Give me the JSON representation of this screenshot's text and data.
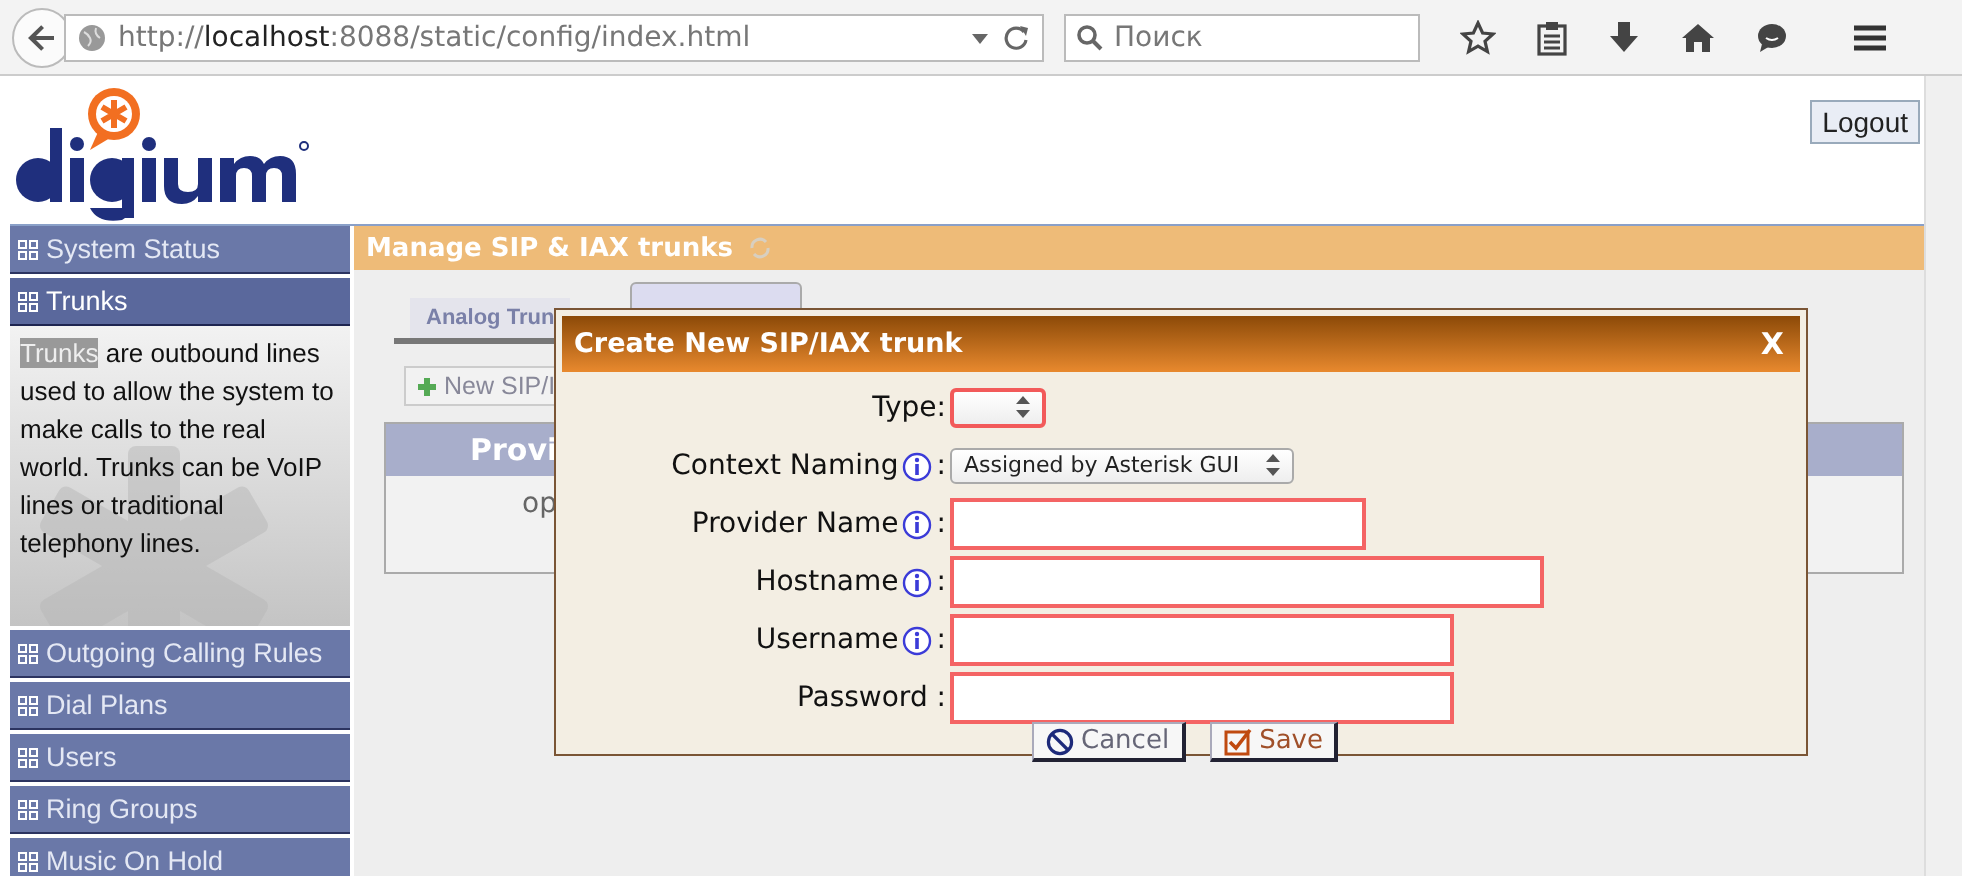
{
  "browser": {
    "url": {
      "scheme": "http://",
      "host": "localhost",
      "path": ":8088/static/config/index.html"
    },
    "search": {
      "placeholder": "Поиск"
    }
  },
  "header": {
    "logout": "Logout"
  },
  "sidebar": {
    "items": [
      {
        "label": "System Status",
        "expanded": false
      },
      {
        "label": "Trunks",
        "expanded": true,
        "description": {
          "highlight": "Trunks",
          "text": " are outbound lines used to allow the system to make calls to the real world. Trunks can be VoIP lines or traditional telephony lines."
        }
      },
      {
        "label": "Outgoing Calling Rules",
        "expanded": false
      },
      {
        "label": "Dial Plans",
        "expanded": false
      },
      {
        "label": "Users",
        "expanded": false
      },
      {
        "label": "Ring Groups",
        "expanded": false
      },
      {
        "label": "Music On Hold",
        "expanded": false
      }
    ]
  },
  "main": {
    "title": "Manage SIP & IAX trunks",
    "tabs": [
      {
        "label": "Analog Trun",
        "selected": false
      },
      {
        "selected": true
      }
    ],
    "new_button": "New SIP/I",
    "table": {
      "columns": [
        "Provi"
      ],
      "rows": [
        [
          "op"
        ]
      ]
    }
  },
  "dialog": {
    "title": "Create New SIP/IAX trunk",
    "close": "X",
    "fields": [
      {
        "kind": "select",
        "label": "Type:",
        "invalid": true
      },
      {
        "kind": "select",
        "label": "Context Naming",
        "colon": ":",
        "info": true,
        "value": "Assigned by Asterisk GUI",
        "invalid": false
      },
      {
        "kind": "text",
        "label": "Provider Name",
        "colon": ":",
        "info": true,
        "invalid": true
      },
      {
        "kind": "text",
        "label": "Hostname",
        "colon": ":",
        "info": true,
        "invalid": true
      },
      {
        "kind": "text",
        "label": "Username",
        "colon": ":",
        "info": true,
        "invalid": true
      },
      {
        "kind": "text",
        "label": "Password :",
        "invalid": true
      }
    ],
    "buttons": [
      {
        "kind": "cancel",
        "label": "Cancel"
      },
      {
        "kind": "save",
        "label": "Save"
      }
    ]
  }
}
